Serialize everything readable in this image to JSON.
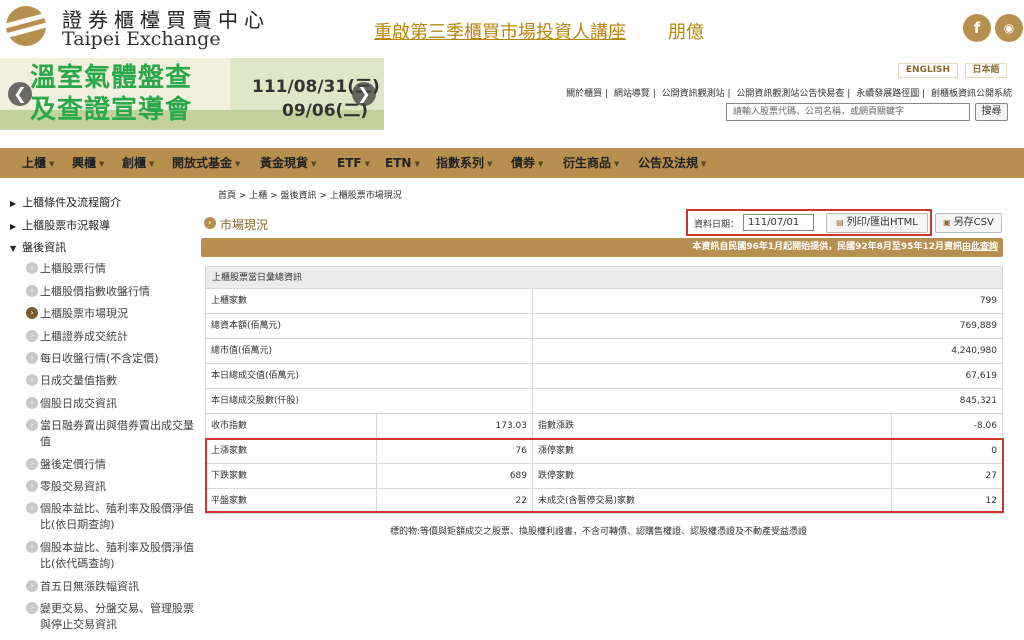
{
  "header": {
    "logo_cn": "證券櫃檯買賣中心",
    "logo_en": "Taipei Exchange",
    "headline": "重啟第三季櫃買市場投資人講座",
    "headline_suffix": "朋億",
    "social": [
      {
        "icon": "facebook-icon",
        "glyph": "f"
      },
      {
        "icon": "rss-icon",
        "glyph": "◉"
      }
    ]
  },
  "banner": {
    "title_line1": "溫室氣體盤查",
    "title_line2": "及查證宣導會",
    "date_start": "111/08/31(三)",
    "date_end": "09/06(二)",
    "prev_glyph": "❮",
    "next_glyph": "❯"
  },
  "lang": {
    "english": "ENGLISH",
    "japanese": "日本語"
  },
  "top_links": [
    "關於櫃買",
    "網站導覽",
    "公開資訊觀測站",
    "公開資訊觀測站公告快易查",
    "永續發展路徑圖",
    "創櫃板資訊公開系統"
  ],
  "search": {
    "placeholder": "請輸入股票代碼、公司名稱，或網頁關鍵字",
    "button": "搜尋"
  },
  "nav": [
    "上櫃",
    "興櫃",
    "創櫃",
    "開放式基金",
    "黃金現貨",
    "ETF",
    "ETN",
    "指數系列",
    "債券",
    "衍生商品",
    "公告及法規"
  ],
  "sidebar": {
    "main_items": [
      "上櫃條件及流程簡介",
      "上櫃股票市況報導",
      "盤後資訊"
    ],
    "sub_items": [
      "上櫃股票行情",
      "上櫃股價指數收盤行情",
      "上櫃股票市場現況",
      "上櫃證券成交統計",
      "每日收盤行情(不含定價)",
      "日成交量值指數",
      "個股日成交資訊",
      "當日融券賣出與借券賣出成交量值",
      "盤後定價行情",
      "零股交易資訊",
      "個股本益比、殖利率及股價淨值比(依日期查詢)",
      "個股本益比、殖利率及股價淨值比(依代碼查詢)",
      "首五日無漲跌幅資訊",
      "變更交易、分盤交易、管理股票與停止交易資訊"
    ]
  },
  "breadcrumb": "首頁 > 上櫃 > 盤後資訊 > 上櫃股票市場現況",
  "section_title": "市場現況",
  "query": {
    "date_label": "資料日期：",
    "date_value": "111/07/01",
    "print_label": "列印/匯出HTML",
    "csv_label": "另存CSV"
  },
  "notice": {
    "text": "本資訊自民國96年1月起開始提供，民國92年8月至95年12月資訊",
    "link": "由此查詢"
  },
  "table": {
    "title": "上櫃股票當日彙總資訊",
    "summary_rows": [
      {
        "label": "上櫃家數",
        "value": "799"
      },
      {
        "label": "總資本額(佰萬元)",
        "value": "769,889"
      },
      {
        "label": "總市值(佰萬元)",
        "value": "4,240,980"
      },
      {
        "label": "本日總成交值(佰萬元)",
        "value": "67,619"
      },
      {
        "label": "本日總成交股數(仟股)",
        "value": "845,321"
      }
    ],
    "pair_rows": [
      {
        "label1": "收市指數",
        "value1": "173.03",
        "label2": "指數漲跌",
        "value2": "-8.06"
      },
      {
        "label1": "上漲家數",
        "value1": "76",
        "label2": "漲停家數",
        "value2": "0"
      },
      {
        "label1": "下跌家數",
        "value1": "689",
        "label2": "跌停家數",
        "value2": "27"
      },
      {
        "label1": "平盤家數",
        "value1": "22",
        "label2": "未成交(含暫停交易)家數",
        "value2": "12"
      }
    ]
  },
  "footnote": "標的物:等價與鉅額成交之股票、換股權利證書，不含可轉債、認購售權證、認股權憑證及不動產受益憑證",
  "colors": {
    "accent": "#b78f4e",
    "highlight_border": "#d0342c",
    "headline": "#b8860b"
  }
}
